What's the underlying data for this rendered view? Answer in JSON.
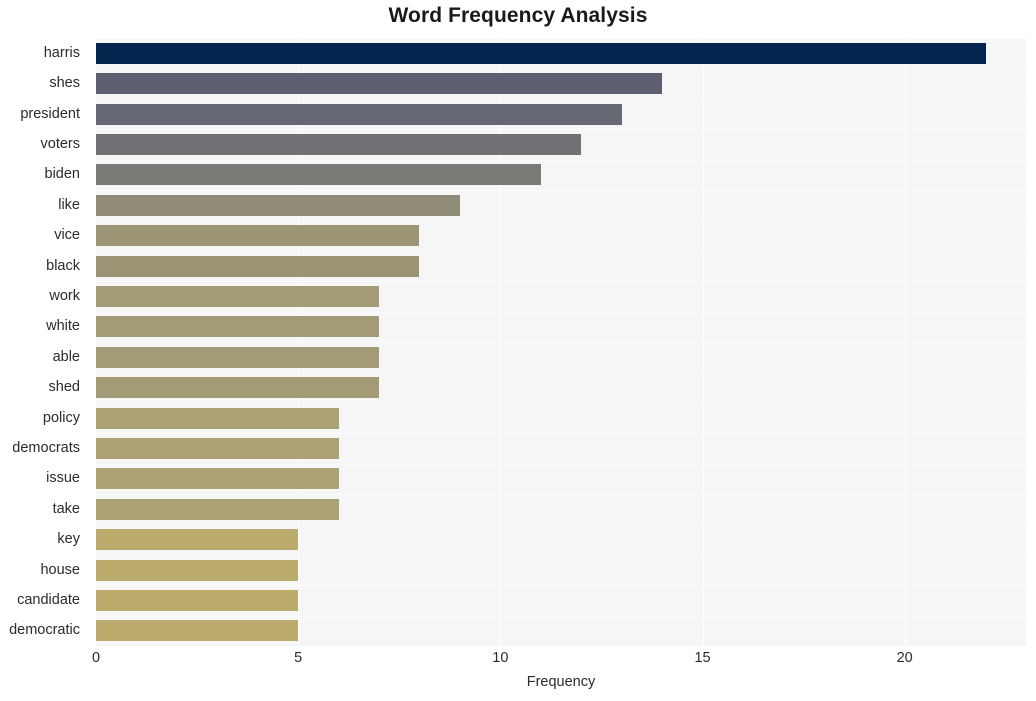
{
  "chart_data": {
    "type": "bar",
    "orientation": "horizontal",
    "title": "Word Frequency Analysis",
    "xlabel": "Frequency",
    "ylabel": "",
    "categories": [
      "harris",
      "shes",
      "president",
      "voters",
      "biden",
      "like",
      "vice",
      "black",
      "work",
      "white",
      "able",
      "shed",
      "policy",
      "democrats",
      "issue",
      "take",
      "key",
      "house",
      "candidate",
      "democratic"
    ],
    "values": [
      22,
      14,
      13,
      12,
      11,
      9,
      8,
      8,
      7,
      7,
      7,
      7,
      6,
      6,
      6,
      6,
      5,
      5,
      5,
      5
    ],
    "bar_colors": [
      "#04254e",
      "#5d6070",
      "#666973",
      "#6f7175",
      "#7b7a77",
      "#8f8b77",
      "#9c9576",
      "#9b9475",
      "#a39a76",
      "#a39a76",
      "#a39a76",
      "#a39a76",
      "#ada273",
      "#ada273",
      "#ada273",
      "#ada273",
      "#bbab6c",
      "#bbab6c",
      "#bbab6c",
      "#bbab6c"
    ],
    "xticks": [
      0,
      5,
      10,
      15,
      20
    ],
    "xtick_labels": [
      "0",
      "5",
      "10",
      "15",
      "20"
    ],
    "xlim": [
      0,
      23.0
    ],
    "grid": true,
    "grid_color": "#ffffff",
    "legend": "none",
    "plot_background": "#f6f6f7",
    "figure_background": "#ffffff",
    "text_color": "#2b2b2b"
  }
}
